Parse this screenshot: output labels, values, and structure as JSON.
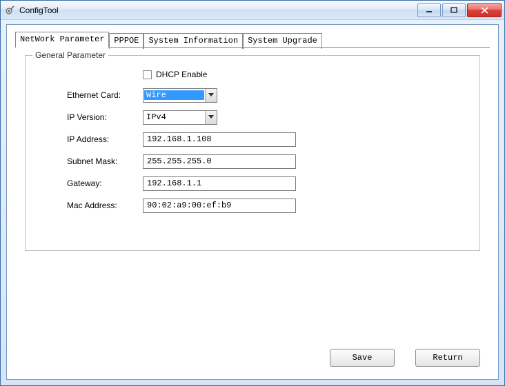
{
  "window": {
    "title": "ConfigTool"
  },
  "tabs": {
    "network": "NetWork Parameter",
    "pppoe": "PPPOE",
    "sysinfo": "System Information",
    "sysupgrade": "System Upgrade"
  },
  "fieldset": {
    "legend": "General Parameter"
  },
  "form": {
    "dhcp_label": "DHCP Enable",
    "ethernet_label": "Ethernet Card:",
    "ethernet_value": "Wire",
    "ipversion_label": "IP Version:",
    "ipversion_value": "IPv4",
    "ipaddress_label": "IP Address:",
    "ipaddress_value": "192.168.1.108",
    "subnet_label": "Subnet Mask:",
    "subnet_value": "255.255.255.0",
    "gateway_label": "Gateway:",
    "gateway_value": "192.168.1.1",
    "mac_label": "Mac Address:",
    "mac_value": "90:02:a9:00:ef:b9"
  },
  "buttons": {
    "save": "Save",
    "return": "Return"
  }
}
